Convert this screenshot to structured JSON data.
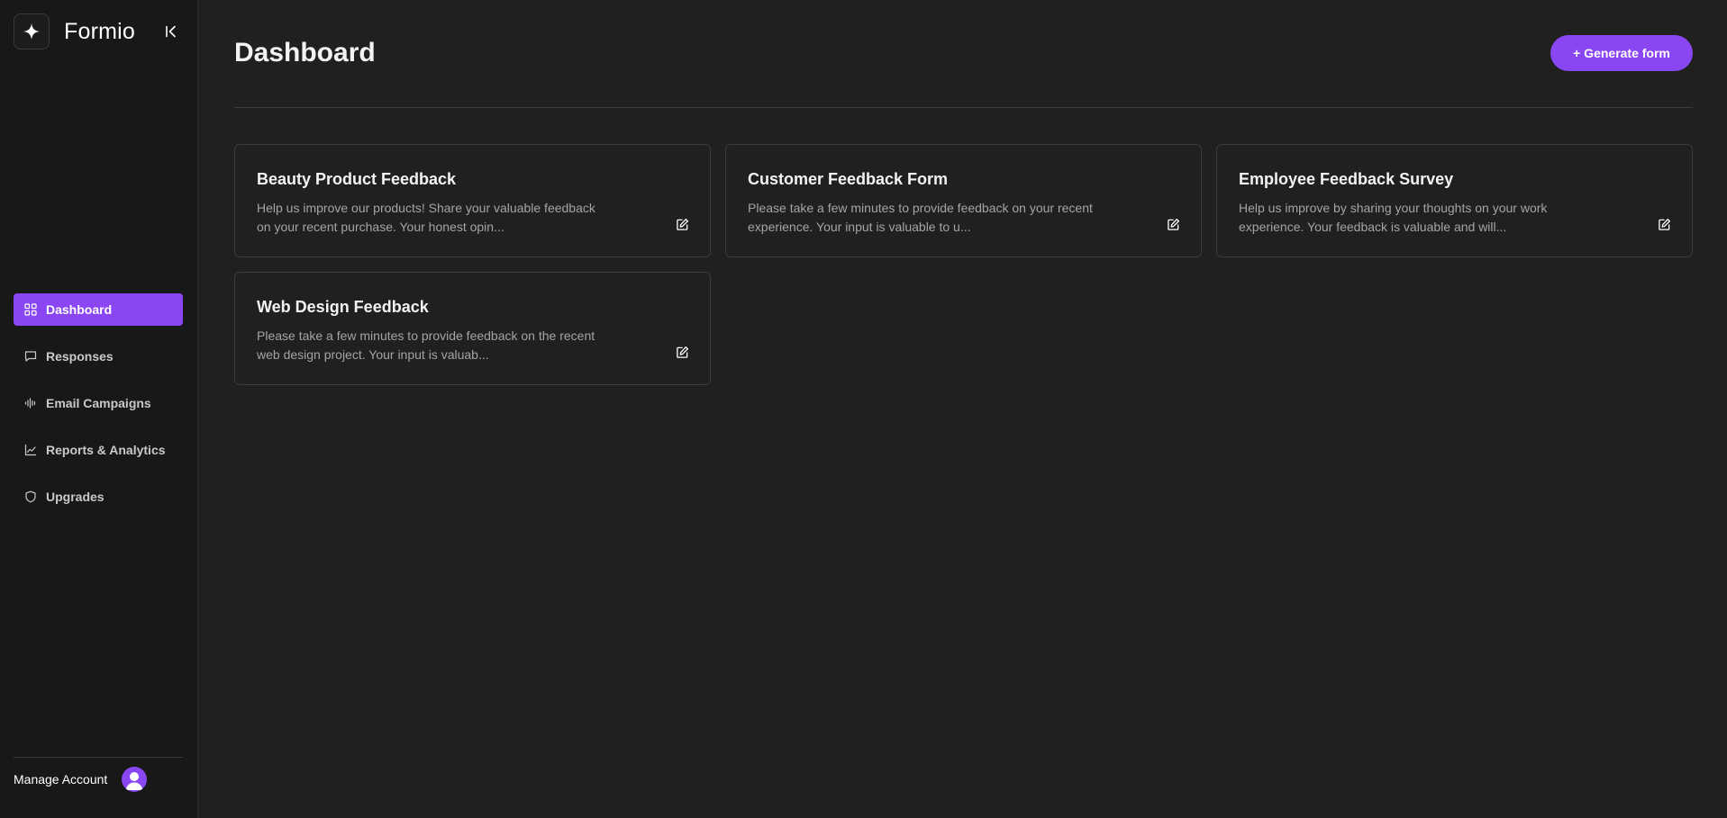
{
  "app": {
    "name": "Formio"
  },
  "sidebar": {
    "items": [
      {
        "label": "Dashboard",
        "icon": "grid-icon",
        "active": true
      },
      {
        "label": "Responses",
        "icon": "message-icon",
        "active": false
      },
      {
        "label": "Email Campaigns",
        "icon": "audio-wave-icon",
        "active": false
      },
      {
        "label": "Reports & Analytics",
        "icon": "line-chart-icon",
        "active": false
      },
      {
        "label": "Upgrades",
        "icon": "shield-icon",
        "active": false
      }
    ],
    "footer": {
      "label": "Manage Account"
    }
  },
  "header": {
    "title": "Dashboard",
    "generate_label": "+ Generate form"
  },
  "forms": [
    {
      "title": "Beauty Product Feedback",
      "description": "Help us improve our products! Share your valuable feedback on your recent purchase. Your honest opin..."
    },
    {
      "title": "Customer Feedback Form",
      "description": "Please take a few minutes to provide feedback on your recent experience. Your input is valuable to u..."
    },
    {
      "title": "Employee Feedback Survey",
      "description": "Help us improve by sharing your thoughts on your work experience. Your feedback is valuable and will..."
    },
    {
      "title": "Web Design Feedback",
      "description": "Please take a few minutes to provide feedback on the recent web design project. Your input is valuab..."
    }
  ],
  "colors": {
    "accent": "#8b46f3",
    "background": "#202020",
    "sidebar": "#181818"
  }
}
